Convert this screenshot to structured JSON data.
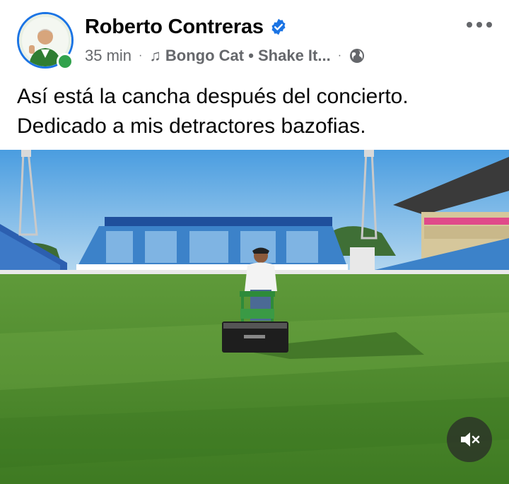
{
  "post": {
    "author_name": "Roberto Contreras",
    "verified_icon": "verified-badge-icon",
    "online_status": "online",
    "time": "35 min",
    "separator": "·",
    "music_icon": "music-note-icon",
    "music_label": "Bongo Cat • Shake It...",
    "audience_icon": "globe-icon",
    "caption_line_1": "Así está la cancha después del concierto.",
    "caption_line_2": "Dedicado a mis detractores bazofias.",
    "more_icon": "more-options-icon",
    "media": {
      "type": "video",
      "muted": true,
      "mute_icon": "volume-muted-icon"
    }
  },
  "colors": {
    "accent": "#1b74e4",
    "online": "#31a24c",
    "secondary_text": "#65676b",
    "primary_text": "#050505"
  }
}
